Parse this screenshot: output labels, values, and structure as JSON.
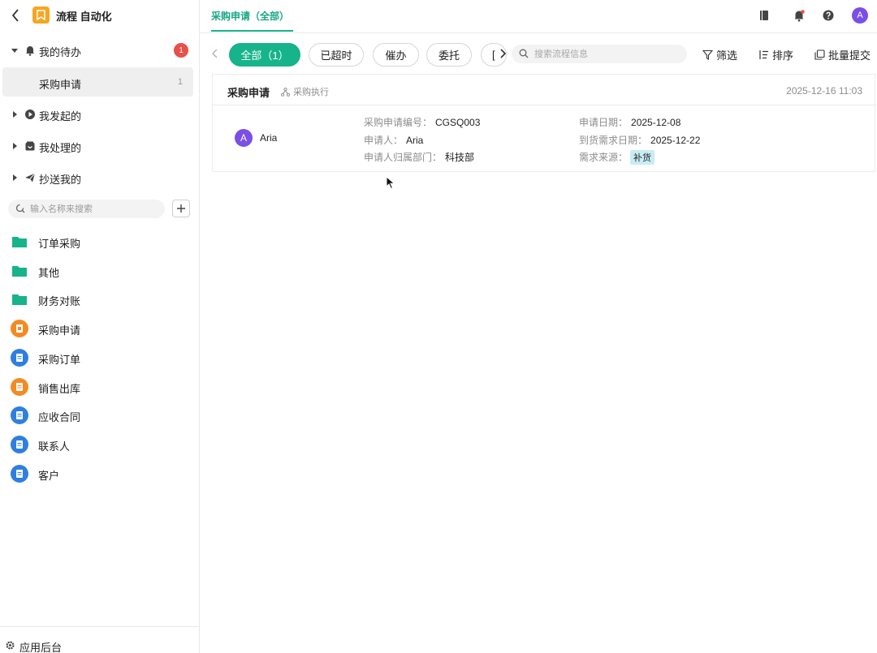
{
  "app": {
    "title": "流程 自动化",
    "back_icon": "chevron-left-icon",
    "logo_icon": "bookmark-icon",
    "logo_color": "#f5a623"
  },
  "sidebar": {
    "todo": {
      "label": "我的待办",
      "badge": "1",
      "icon": "bell-icon"
    },
    "todo_items": [
      {
        "label": "采购申请",
        "count": "1"
      }
    ],
    "groups": [
      {
        "label": "我发起的",
        "icon": "play-circle-icon"
      },
      {
        "label": "我处理的",
        "icon": "inbox-icon"
      },
      {
        "label": "抄送我的",
        "icon": "send-icon"
      }
    ],
    "search": {
      "placeholder": "输入名称来搜索",
      "value": ""
    },
    "nav": [
      {
        "label": "订单采购",
        "icon": "folder-icon",
        "color": "#17b38a"
      },
      {
        "label": "其他",
        "icon": "folder-icon",
        "color": "#17b38a"
      },
      {
        "label": "财务对账",
        "icon": "folder-icon",
        "color": "#17b38a"
      },
      {
        "label": "采购申请",
        "icon": "form-icon",
        "color": "#f28b24"
      },
      {
        "label": "采购订单",
        "icon": "document-icon",
        "color": "#2f7fe0"
      },
      {
        "label": "销售出库",
        "icon": "document-icon",
        "color": "#f28b24"
      },
      {
        "label": "应收合同",
        "icon": "document-icon",
        "color": "#2f7fe0"
      },
      {
        "label": "联系人",
        "icon": "document-icon",
        "color": "#2f7fe0"
      },
      {
        "label": "客户",
        "icon": "document-icon",
        "color": "#2f7fe0"
      }
    ],
    "footer": {
      "label": "应用后台",
      "icon": "gear-icon"
    }
  },
  "topbar": {
    "tab": "采购申请（全部）",
    "accent": "#17b38a",
    "icons": [
      "book-icon",
      "bell-icon",
      "help-icon"
    ],
    "avatar": "A"
  },
  "filters": {
    "chips": [
      {
        "label": "全部（1）",
        "active": true
      },
      {
        "label": "已超时",
        "active": false
      },
      {
        "label": "催办",
        "active": false
      },
      {
        "label": "委托",
        "active": false
      },
      {
        "label": "[",
        "active": false
      }
    ],
    "search": {
      "placeholder": "搜索流程信息",
      "value": ""
    },
    "actions": [
      {
        "label": "筛选",
        "icon": "filter-icon"
      },
      {
        "label": "排序",
        "icon": "sort-icon"
      },
      {
        "label": "批量提交",
        "icon": "batch-icon"
      }
    ]
  },
  "record": {
    "title": "采购申请",
    "flow": "采购执行",
    "time": "2025-12-16 11:03",
    "user": {
      "initial": "A",
      "name": "Aria"
    },
    "fields_left": [
      {
        "key": "采购申请编号：",
        "value": "CGSQ003"
      },
      {
        "key": "申请人：",
        "value": "Aria"
      },
      {
        "key": "申请人归属部门：",
        "value": "科技部"
      }
    ],
    "fields_right": [
      {
        "key": "申请日期：",
        "value": "2025-12-08"
      },
      {
        "key": "到货需求日期：",
        "value": "2025-12-22"
      },
      {
        "key": "需求来源：",
        "value": "补货"
      }
    ]
  }
}
